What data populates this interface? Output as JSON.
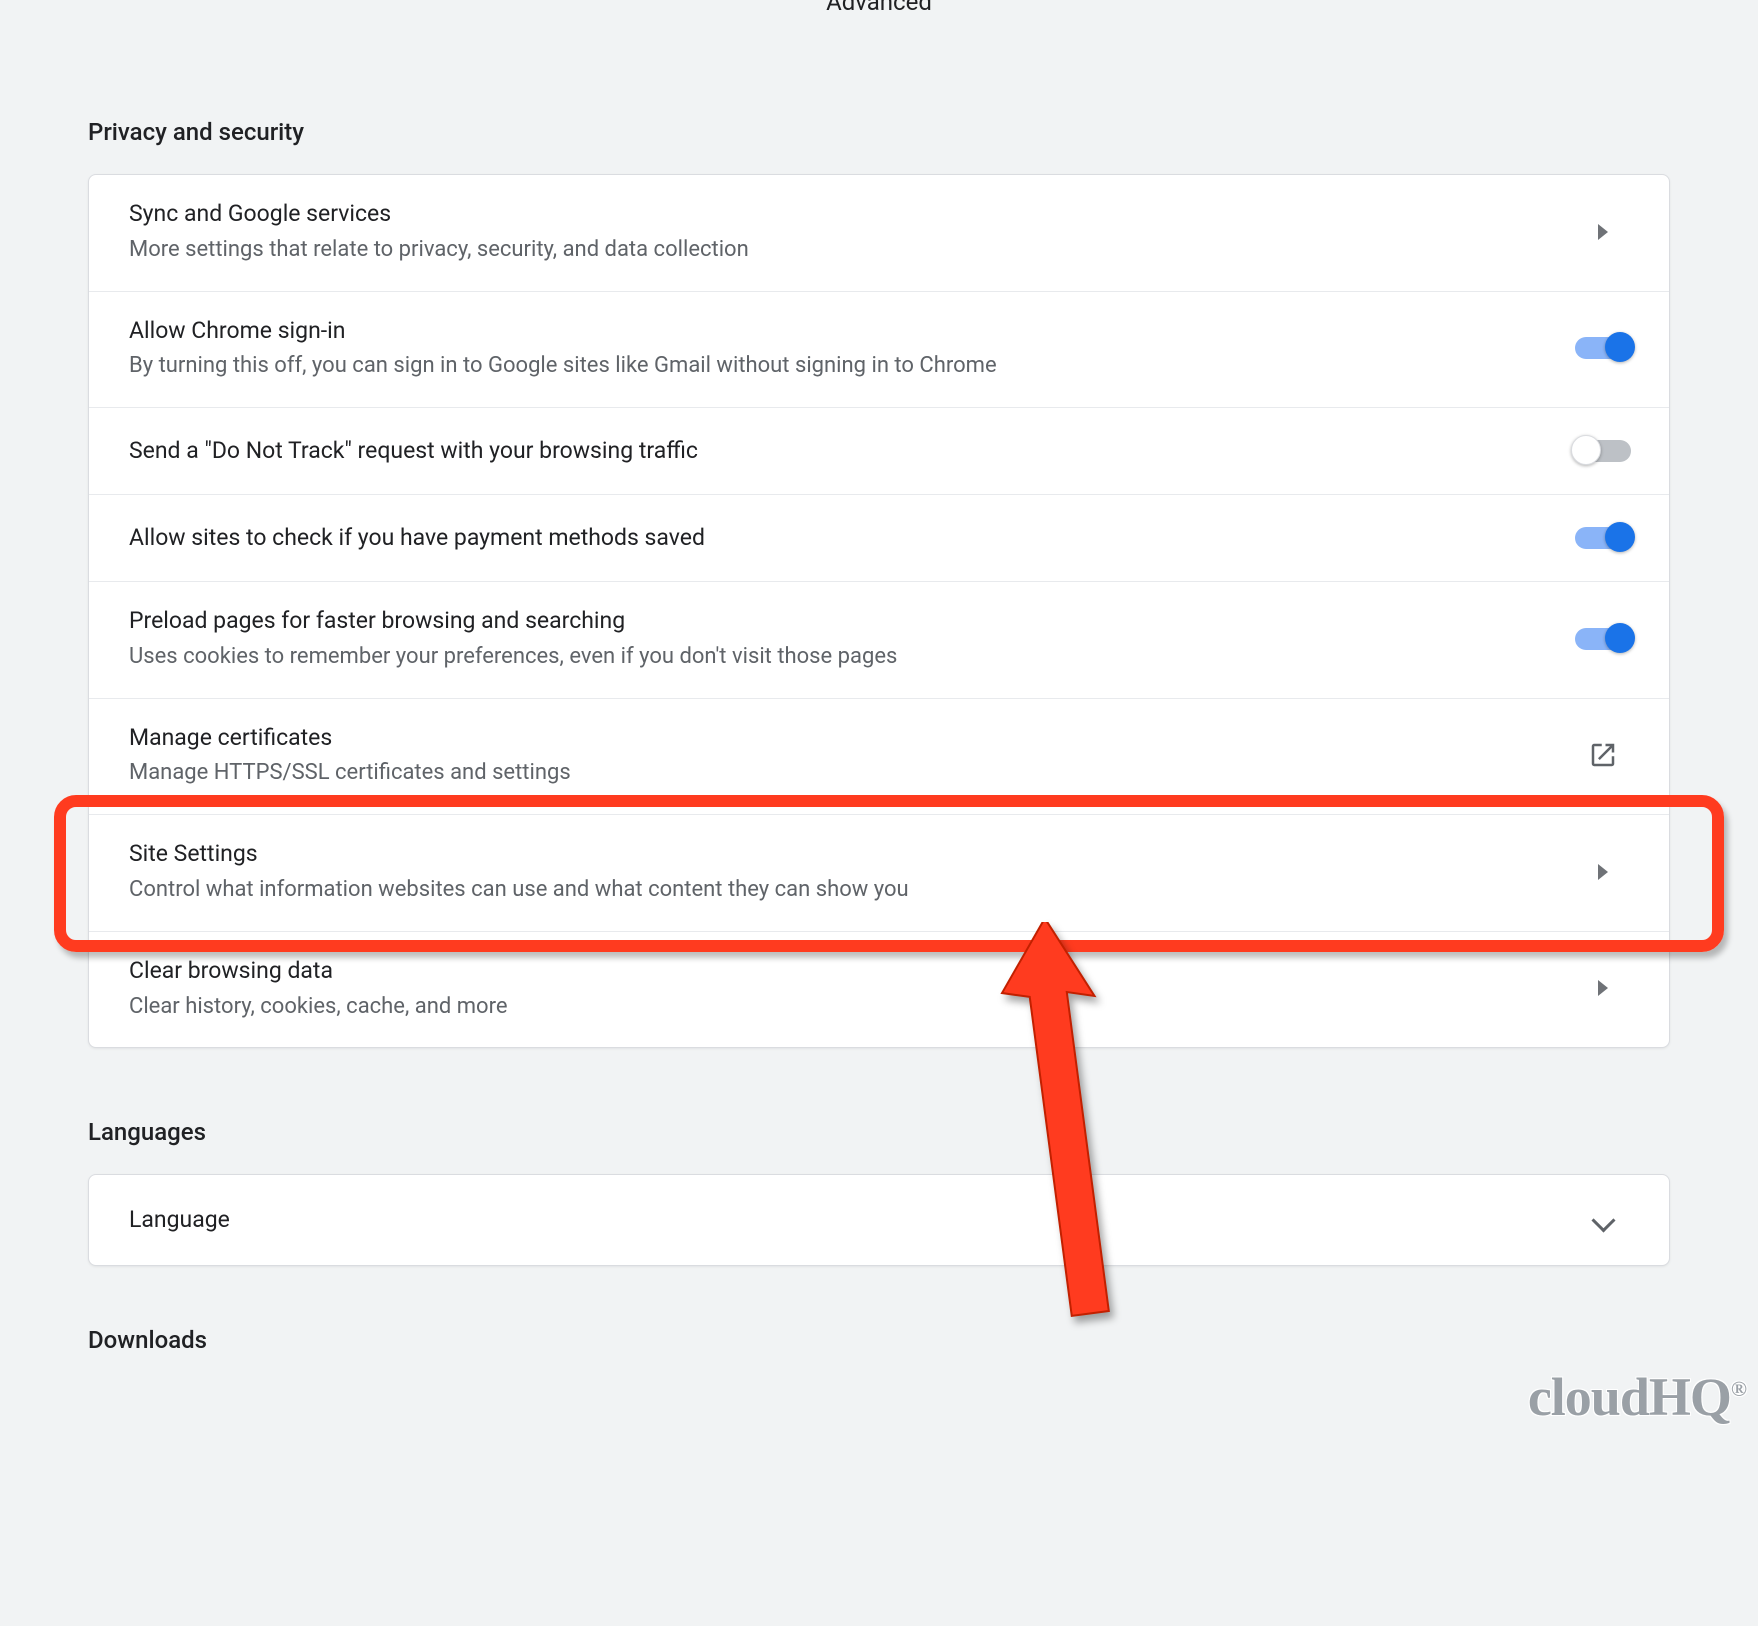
{
  "top_header": "Advanced",
  "sections": {
    "privacy": {
      "title": "Privacy and security",
      "rows": [
        {
          "title": "Sync and Google services",
          "sub": "More settings that relate to privacy, security, and data collection",
          "right": "arrow"
        },
        {
          "title": "Allow Chrome sign-in",
          "sub": "By turning this off, you can sign in to Google sites like Gmail without signing in to Chrome",
          "right": "toggle-on"
        },
        {
          "title": "Send a \"Do Not Track\" request with your browsing traffic",
          "sub": "",
          "right": "toggle-off"
        },
        {
          "title": "Allow sites to check if you have payment methods saved",
          "sub": "",
          "right": "toggle-on"
        },
        {
          "title": "Preload pages for faster browsing and searching",
          "sub": "Uses cookies to remember your preferences, even if you don't visit those pages",
          "right": "toggle-on"
        },
        {
          "title": "Manage certificates",
          "sub": "Manage HTTPS/SSL certificates and settings",
          "right": "external"
        },
        {
          "title": "Site Settings",
          "sub": "Control what information websites can use and what content they can show you",
          "right": "arrow"
        },
        {
          "title": "Clear browsing data",
          "sub": "Clear history, cookies, cache, and more",
          "right": "arrow"
        }
      ]
    },
    "languages": {
      "title": "Languages",
      "row": {
        "title": "Language",
        "right": "chevron"
      }
    },
    "downloads": {
      "title": "Downloads"
    }
  },
  "annotation": {
    "highlight_color": "#ff3b1f"
  },
  "watermark": "cloudHQ"
}
